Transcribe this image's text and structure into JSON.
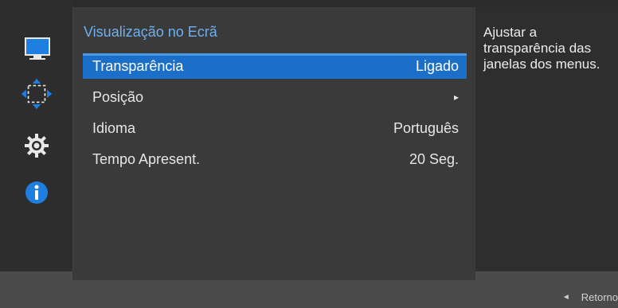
{
  "menu": {
    "title": "Visualização no Ecrã",
    "items": [
      {
        "label": "Transparência",
        "value": "Ligado",
        "selected": true
      },
      {
        "label": "Posição",
        "value": "▸",
        "selected": false
      },
      {
        "label": "Idioma",
        "value": "Português",
        "selected": false
      },
      {
        "label": "Tempo Apresent.",
        "value": "20 Seg.",
        "selected": false
      }
    ]
  },
  "sidebar": {
    "icons": [
      "monitor-icon",
      "position-arrows-icon",
      "gear-icon",
      "info-icon"
    ]
  },
  "description": {
    "text": "Ajustar a transparência das janelas dos menus."
  },
  "footer": {
    "back_glyph": "◄",
    "back_label": "Retorno"
  },
  "colors": {
    "accent": "#1c6fc8",
    "title": "#6fb0ee"
  }
}
